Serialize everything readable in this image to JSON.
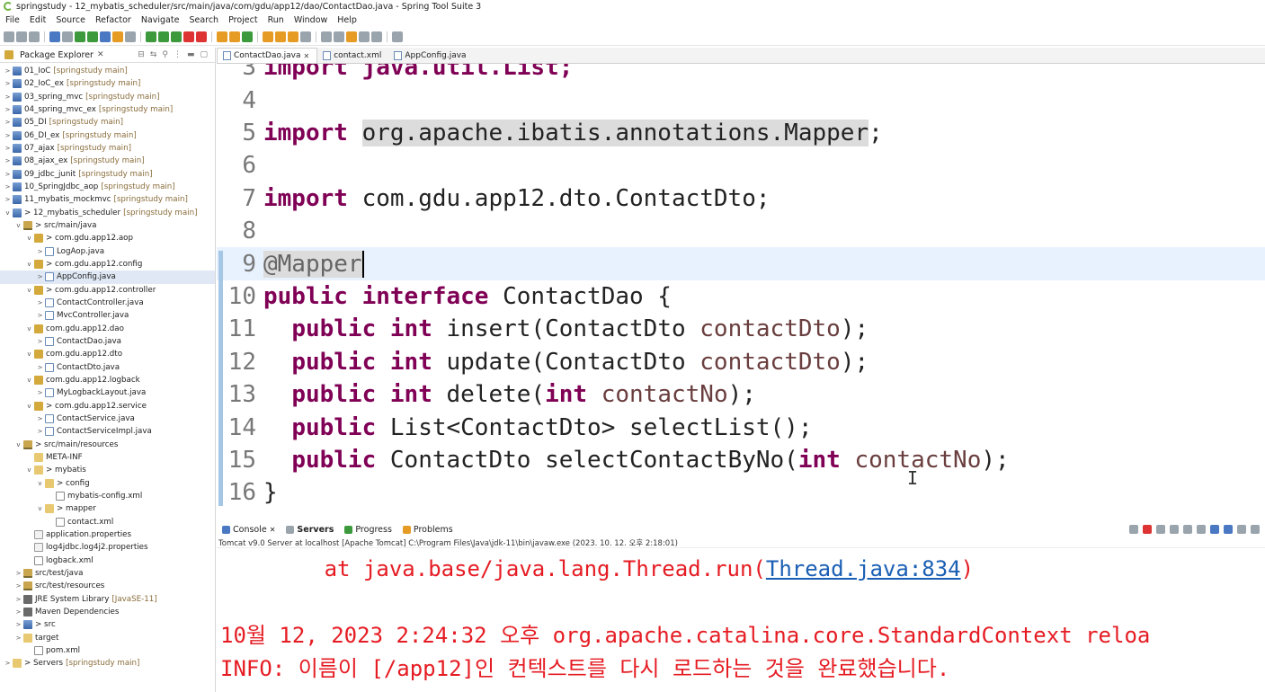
{
  "window": {
    "title": "springstudy - 12_mybatis_scheduler/src/main/java/com/gdu/app12/dao/ContactDao.java - Spring Tool Suite 3"
  },
  "menu": [
    "File",
    "Edit",
    "Source",
    "Refactor",
    "Navigate",
    "Search",
    "Project",
    "Run",
    "Window",
    "Help"
  ],
  "explorer": {
    "tab_label": "Package Explorer",
    "rows": [
      {
        "indent": 0,
        "twisty": ">",
        "icon": "project",
        "label": "01_IoC",
        "suffix": "[springstudy main]"
      },
      {
        "indent": 0,
        "twisty": ">",
        "icon": "project",
        "label": "02_IoC_ex",
        "suffix": "[springstudy main]"
      },
      {
        "indent": 0,
        "twisty": ">",
        "icon": "project",
        "label": "03_spring_mvc",
        "suffix": "[springstudy main]"
      },
      {
        "indent": 0,
        "twisty": ">",
        "icon": "project",
        "label": "04_spring_mvc_ex",
        "suffix": "[springstudy main]"
      },
      {
        "indent": 0,
        "twisty": ">",
        "icon": "project",
        "label": "05_DI",
        "suffix": "[springstudy main]"
      },
      {
        "indent": 0,
        "twisty": ">",
        "icon": "project",
        "label": "06_DI_ex",
        "suffix": "[springstudy main]"
      },
      {
        "indent": 0,
        "twisty": ">",
        "icon": "project",
        "label": "07_ajax",
        "suffix": "[springstudy main]"
      },
      {
        "indent": 0,
        "twisty": ">",
        "icon": "project",
        "label": "08_ajax_ex",
        "suffix": "[springstudy main]"
      },
      {
        "indent": 0,
        "twisty": ">",
        "icon": "project",
        "label": "09_jdbc_junit",
        "suffix": "[springstudy main]"
      },
      {
        "indent": 0,
        "twisty": ">",
        "icon": "project",
        "label": "10_SpringJdbc_aop",
        "suffix": "[springstudy main]"
      },
      {
        "indent": 0,
        "twisty": ">",
        "icon": "project",
        "label": "11_mybatis_mockmvc",
        "suffix": "[springstudy main]"
      },
      {
        "indent": 0,
        "twisty": "v",
        "icon": "project",
        "label": "> 12_mybatis_scheduler",
        "suffix": "[springstudy main]"
      },
      {
        "indent": 1,
        "twisty": "v",
        "icon": "srcfolder",
        "label": "> src/main/java",
        "suffix": ""
      },
      {
        "indent": 2,
        "twisty": "v",
        "icon": "package",
        "label": "> com.gdu.app12.aop",
        "suffix": ""
      },
      {
        "indent": 3,
        "twisty": ">",
        "icon": "java",
        "label": "LogAop.java",
        "suffix": ""
      },
      {
        "indent": 2,
        "twisty": "v",
        "icon": "package",
        "label": "> com.gdu.app12.config",
        "suffix": ""
      },
      {
        "indent": 3,
        "twisty": ">",
        "icon": "java",
        "label": "AppConfig.java",
        "suffix": "",
        "selected": true
      },
      {
        "indent": 2,
        "twisty": "v",
        "icon": "package",
        "label": "> com.gdu.app12.controller",
        "suffix": ""
      },
      {
        "indent": 3,
        "twisty": ">",
        "icon": "java",
        "label": "ContactController.java",
        "suffix": ""
      },
      {
        "indent": 3,
        "twisty": ">",
        "icon": "java",
        "label": "MvcController.java",
        "suffix": ""
      },
      {
        "indent": 2,
        "twisty": "v",
        "icon": "package",
        "label": "com.gdu.app12.dao",
        "suffix": ""
      },
      {
        "indent": 3,
        "twisty": ">",
        "icon": "java",
        "label": "ContactDao.java",
        "suffix": ""
      },
      {
        "indent": 2,
        "twisty": "v",
        "icon": "package",
        "label": "com.gdu.app12.dto",
        "suffix": ""
      },
      {
        "indent": 3,
        "twisty": ">",
        "icon": "java",
        "label": "ContactDto.java",
        "suffix": ""
      },
      {
        "indent": 2,
        "twisty": "v",
        "icon": "package",
        "label": "com.gdu.app12.logback",
        "suffix": ""
      },
      {
        "indent": 3,
        "twisty": ">",
        "icon": "java",
        "label": "MyLogbackLayout.java",
        "suffix": ""
      },
      {
        "indent": 2,
        "twisty": "v",
        "icon": "package",
        "label": "> com.gdu.app12.service",
        "suffix": ""
      },
      {
        "indent": 3,
        "twisty": ">",
        "icon": "java",
        "label": "ContactService.java",
        "suffix": ""
      },
      {
        "indent": 3,
        "twisty": ">",
        "icon": "java",
        "label": "ContactServiceImpl.java",
        "suffix": ""
      },
      {
        "indent": 1,
        "twisty": "v",
        "icon": "srcfolder",
        "label": "> src/main/resources",
        "suffix": ""
      },
      {
        "indent": 2,
        "twisty": "",
        "icon": "folder",
        "label": "META-INF",
        "suffix": ""
      },
      {
        "indent": 2,
        "twisty": "v",
        "icon": "folder",
        "label": "> mybatis",
        "suffix": ""
      },
      {
        "indent": 3,
        "twisty": "v",
        "icon": "folder",
        "label": "> config",
        "suffix": ""
      },
      {
        "indent": 4,
        "twisty": "",
        "icon": "xml",
        "label": "mybatis-config.xml",
        "suffix": ""
      },
      {
        "indent": 3,
        "twisty": "v",
        "icon": "folder",
        "label": "> mapper",
        "suffix": ""
      },
      {
        "indent": 4,
        "twisty": "",
        "icon": "xml",
        "label": "contact.xml",
        "suffix": ""
      },
      {
        "indent": 2,
        "twisty": "",
        "icon": "props",
        "label": "application.properties",
        "suffix": ""
      },
      {
        "indent": 2,
        "twisty": "",
        "icon": "props",
        "label": "log4jdbc.log4j2.properties",
        "suffix": ""
      },
      {
        "indent": 2,
        "twisty": "",
        "icon": "xml",
        "label": "logback.xml",
        "suffix": ""
      },
      {
        "indent": 1,
        "twisty": ">",
        "icon": "srcfolder",
        "label": "src/test/java",
        "suffix": ""
      },
      {
        "indent": 1,
        "twisty": ">",
        "icon": "srcfolder",
        "label": "src/test/resources",
        "suffix": ""
      },
      {
        "indent": 1,
        "twisty": ">",
        "icon": "lib",
        "label": "JRE System Library",
        "suffix": "[JavaSE-11]"
      },
      {
        "indent": 1,
        "twisty": ">",
        "icon": "lib",
        "label": "Maven Dependencies",
        "suffix": ""
      },
      {
        "indent": 1,
        "twisty": ">",
        "icon": "project",
        "label": "> src",
        "suffix": ""
      },
      {
        "indent": 1,
        "twisty": ">",
        "icon": "folder",
        "label": "target",
        "suffix": ""
      },
      {
        "indent": 2,
        "twisty": "",
        "icon": "xml",
        "label": "pom.xml",
        "suffix": ""
      },
      {
        "indent": 0,
        "twisty": ">",
        "icon": "folder",
        "label": "> Servers",
        "suffix": "[springstudy main]"
      }
    ]
  },
  "editor": {
    "tabs": [
      {
        "label": "ContactDao.java",
        "active": true
      },
      {
        "label": "contact.xml",
        "active": false
      },
      {
        "label": "AppConfig.java",
        "active": false
      }
    ],
    "lines": [
      {
        "n": "3",
        "tokens": [
          {
            "t": "import java.util.List;",
            "c": "kwfirst"
          }
        ]
      },
      {
        "n": "4",
        "tokens": []
      },
      {
        "n": "5",
        "tokens": [
          {
            "t": "import",
            "c": "kw"
          },
          {
            "t": " ",
            "c": ""
          },
          {
            "t": "org.apache.ibatis.annotations.Mapper",
            "c": "hl"
          },
          {
            "t": ";",
            "c": ""
          }
        ]
      },
      {
        "n": "6",
        "tokens": []
      },
      {
        "n": "7",
        "tokens": [
          {
            "t": "import",
            "c": "kw"
          },
          {
            "t": " com.gdu.app12.dto.ContactDto;",
            "c": ""
          }
        ]
      },
      {
        "n": "8",
        "tokens": []
      },
      {
        "n": "9",
        "tokens": [
          {
            "t": "@Mapper",
            "c": "ann"
          }
        ],
        "current": true
      },
      {
        "n": "10",
        "tokens": [
          {
            "t": "public",
            "c": "kw"
          },
          {
            "t": " ",
            "c": ""
          },
          {
            "t": "interface",
            "c": "kw"
          },
          {
            "t": " ContactDao {",
            "c": ""
          }
        ]
      },
      {
        "n": "11",
        "tokens": [
          {
            "t": "  ",
            "c": ""
          },
          {
            "t": "public",
            "c": "kw"
          },
          {
            "t": " ",
            "c": ""
          },
          {
            "t": "int",
            "c": "kw"
          },
          {
            "t": " insert(ContactDto ",
            "c": ""
          },
          {
            "t": "contactDto",
            "c": "param"
          },
          {
            "t": ");",
            "c": ""
          }
        ]
      },
      {
        "n": "12",
        "tokens": [
          {
            "t": "  ",
            "c": ""
          },
          {
            "t": "public",
            "c": "kw"
          },
          {
            "t": " ",
            "c": ""
          },
          {
            "t": "int",
            "c": "kw"
          },
          {
            "t": " update(ContactDto ",
            "c": ""
          },
          {
            "t": "contactDto",
            "c": "param"
          },
          {
            "t": ");",
            "c": ""
          }
        ]
      },
      {
        "n": "13",
        "tokens": [
          {
            "t": "  ",
            "c": ""
          },
          {
            "t": "public",
            "c": "kw"
          },
          {
            "t": " ",
            "c": ""
          },
          {
            "t": "int",
            "c": "kw"
          },
          {
            "t": " delete(",
            "c": ""
          },
          {
            "t": "int",
            "c": "kw"
          },
          {
            "t": " ",
            "c": ""
          },
          {
            "t": "contactNo",
            "c": "param"
          },
          {
            "t": ");",
            "c": ""
          }
        ]
      },
      {
        "n": "14",
        "tokens": [
          {
            "t": "  ",
            "c": ""
          },
          {
            "t": "public",
            "c": "kw"
          },
          {
            "t": " List<ContactDto> selectList();",
            "c": ""
          }
        ]
      },
      {
        "n": "15",
        "tokens": [
          {
            "t": "  ",
            "c": ""
          },
          {
            "t": "public",
            "c": "kw"
          },
          {
            "t": " ContactDto selectContactByNo(",
            "c": ""
          },
          {
            "t": "int",
            "c": "kw"
          },
          {
            "t": " ",
            "c": ""
          },
          {
            "t": "contactNo",
            "c": "param"
          },
          {
            "t": ");",
            "c": ""
          }
        ]
      },
      {
        "n": "16",
        "tokens": [
          {
            "t": "}",
            "c": ""
          }
        ]
      }
    ]
  },
  "console": {
    "tabs": [
      "Console",
      "Servers",
      "Progress",
      "Problems"
    ],
    "active_tab": "Servers",
    "description": "Tomcat v9.0 Server at localhost [Apache Tomcat] C:\\Program Files\\Java\\jdk-11\\bin\\javaw.exe  (2023. 10. 12. 오후 2:18:01)",
    "line1_prefix": "        at java.base/java.lang.Thread.run(",
    "line1_link": "Thread.java:834",
    "line1_suffix": ")",
    "line2": "10월 12, 2023 2:24:32 오후 org.apache.catalina.core.StandardContext reloa",
    "line3": "INFO: 이름이 [/app12]인 컨텍스트를 다시 로드하는 것을 완료했습니다.",
    "text_color": "#e51c23",
    "link_color": "#1a5fb4"
  }
}
